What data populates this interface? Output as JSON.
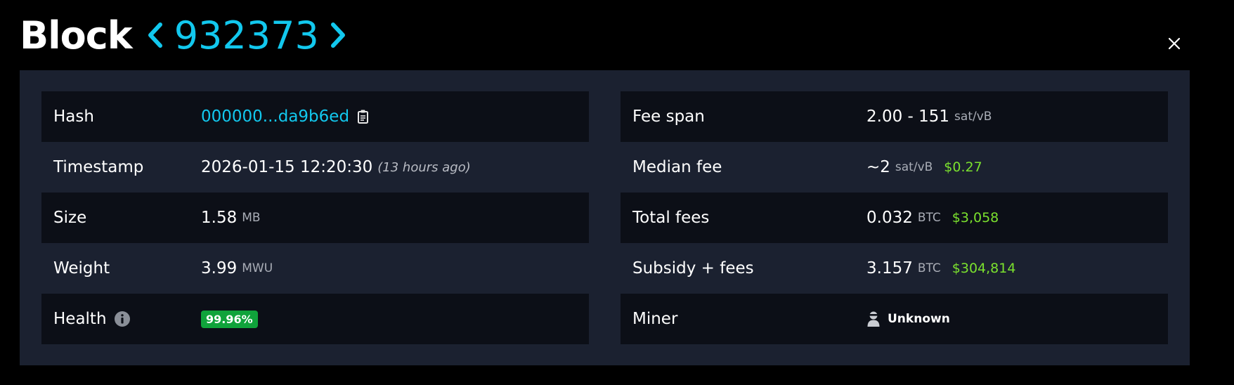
{
  "header": {
    "title": "Block",
    "block_height": "932373"
  },
  "icons": {
    "prev": "chevron-left-icon",
    "next": "chevron-right-icon",
    "close": "close-icon",
    "copy": "clipboard-copy-icon",
    "info": "info-circle-icon",
    "miner": "user-icon"
  },
  "colors": {
    "accent": "#12c8ee",
    "fiat": "#7be12e",
    "health_badge": "#10a33b",
    "panel": "#1b2130",
    "row_dark": "#0c0f17"
  },
  "details_left": {
    "hash": {
      "label": "Hash",
      "value": "000000...da9b6ed"
    },
    "timestamp": {
      "label": "Timestamp",
      "value": "2026-01-15 12:20:30",
      "relative": "(13 hours ago)"
    },
    "size": {
      "label": "Size",
      "value": "1.58",
      "unit": "MB"
    },
    "weight": {
      "label": "Weight",
      "value": "3.99",
      "unit": "MWU"
    },
    "health": {
      "label": "Health",
      "value": "99.96%"
    }
  },
  "details_right": {
    "fee_span": {
      "label": "Fee span",
      "value": "2.00 - 151",
      "unit": "sat/vB"
    },
    "median_fee": {
      "label": "Median fee",
      "value": "~2",
      "unit": "sat/vB",
      "fiat": "$0.27"
    },
    "total_fees": {
      "label": "Total fees",
      "value": "0.032",
      "unit": "BTC",
      "fiat": "$3,058"
    },
    "subsidy_fees": {
      "label": "Subsidy + fees",
      "value": "3.157",
      "unit": "BTC",
      "fiat": "$304,814"
    },
    "miner": {
      "label": "Miner",
      "value": "Unknown"
    }
  }
}
